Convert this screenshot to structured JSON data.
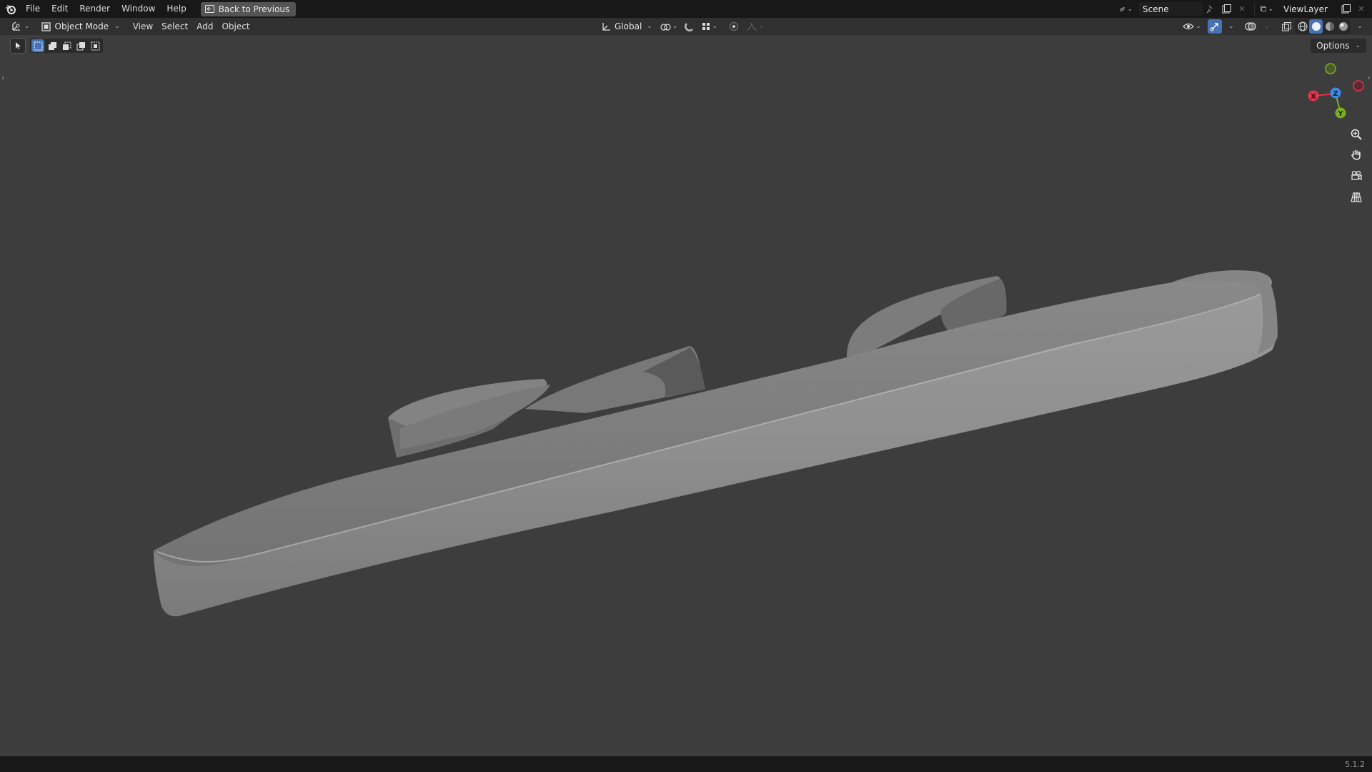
{
  "menu": {
    "file": "File",
    "edit": "Edit",
    "render": "Render",
    "window": "Window",
    "help": "Help",
    "back_to_previous": "Back to Previous"
  },
  "top_right": {
    "scene": "Scene",
    "view_layer": "ViewLayer"
  },
  "header": {
    "mode": "Object Mode",
    "view": "View",
    "select": "Select",
    "add": "Add",
    "object": "Object",
    "transform_orientation": "Global",
    "options": "Options"
  },
  "gizmo": {
    "x_label": "X",
    "y_label": "Y",
    "z_label": "Z"
  },
  "icons": {
    "logo": "blender-logo-icon",
    "editor_type": "3d-viewport-icon",
    "zoom": "zoom-icon",
    "pan": "hand-icon",
    "camera": "camera-icon",
    "perspective": "grid-icon"
  },
  "colors": {
    "viewport_bg": "#3d3d3d",
    "accent": "#4772b3",
    "axis_x": "#e5334d",
    "axis_y": "#79b01c",
    "axis_z": "#3d88e3"
  },
  "status": {
    "version": "5.1.2"
  }
}
